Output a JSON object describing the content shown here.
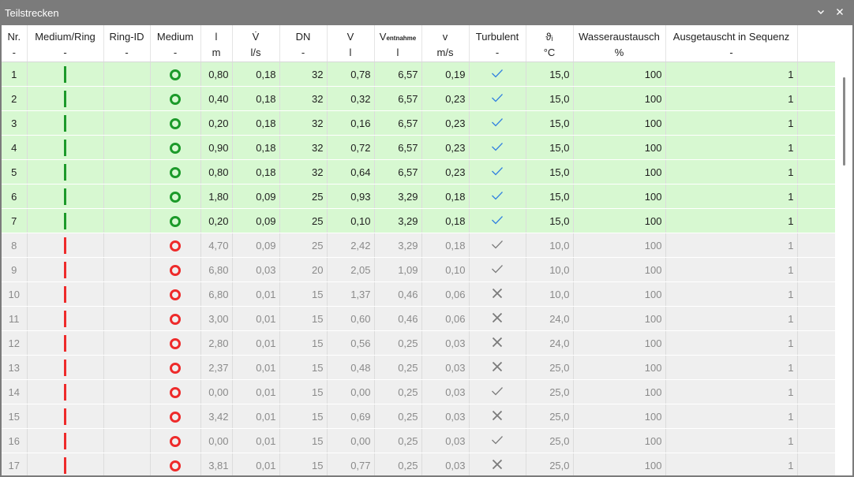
{
  "window": {
    "title": "Teilstrecken",
    "minimize_icon": "chevron-down",
    "close_icon": "close"
  },
  "columns": [
    {
      "key": "nr",
      "label": "Nr.",
      "unit": "-"
    },
    {
      "key": "medium_ring",
      "label": "Medium/Ring",
      "unit": "-"
    },
    {
      "key": "ring_id",
      "label": "Ring-ID",
      "unit": "-"
    },
    {
      "key": "medium",
      "label": "Medium",
      "unit": "-"
    },
    {
      "key": "l",
      "label": "l",
      "unit": "m"
    },
    {
      "key": "vdot",
      "label": "V̇",
      "unit": "l/s"
    },
    {
      "key": "dn",
      "label": "DN",
      "unit": "-"
    },
    {
      "key": "v",
      "label": "V",
      "unit": "l"
    },
    {
      "key": "ventnahme",
      "label": "V",
      "label_sub": "entnahme",
      "unit": "l"
    },
    {
      "key": "velocity",
      "label": "v",
      "unit": "m/s"
    },
    {
      "key": "turbulent",
      "label": "Turbulent",
      "unit": "-"
    },
    {
      "key": "theta",
      "label": "ϑᵢ",
      "unit": "°C"
    },
    {
      "key": "wasseraustausch",
      "label": "Wasseraustausch",
      "unit": "%"
    },
    {
      "key": "sequenz",
      "label": "Ausgetauscht in Sequenz",
      "unit": "-"
    }
  ],
  "colors": {
    "active_bar": "#1c9a2a",
    "inactive_bar": "#ee2b2b",
    "active_row": "#d7f8d1",
    "inactive_row": "#efefef",
    "check_active": "#2f7fe0",
    "mark_inactive": "#7a7a7a"
  },
  "rows": [
    {
      "nr": "1",
      "state": "active",
      "l": "0,80",
      "vdot": "0,18",
      "dn": "32",
      "v": "0,78",
      "ventnahme": "6,57",
      "velocity": "0,19",
      "turbulent": "check",
      "theta": "15,0",
      "wasseraustausch": "100",
      "sequenz": "1"
    },
    {
      "nr": "2",
      "state": "active",
      "l": "0,40",
      "vdot": "0,18",
      "dn": "32",
      "v": "0,32",
      "ventnahme": "6,57",
      "velocity": "0,23",
      "turbulent": "check",
      "theta": "15,0",
      "wasseraustausch": "100",
      "sequenz": "1"
    },
    {
      "nr": "3",
      "state": "active",
      "l": "0,20",
      "vdot": "0,18",
      "dn": "32",
      "v": "0,16",
      "ventnahme": "6,57",
      "velocity": "0,23",
      "turbulent": "check",
      "theta": "15,0",
      "wasseraustausch": "100",
      "sequenz": "1"
    },
    {
      "nr": "4",
      "state": "active",
      "l": "0,90",
      "vdot": "0,18",
      "dn": "32",
      "v": "0,72",
      "ventnahme": "6,57",
      "velocity": "0,23",
      "turbulent": "check",
      "theta": "15,0",
      "wasseraustausch": "100",
      "sequenz": "1"
    },
    {
      "nr": "5",
      "state": "active",
      "l": "0,80",
      "vdot": "0,18",
      "dn": "32",
      "v": "0,64",
      "ventnahme": "6,57",
      "velocity": "0,23",
      "turbulent": "check",
      "theta": "15,0",
      "wasseraustausch": "100",
      "sequenz": "1"
    },
    {
      "nr": "6",
      "state": "active",
      "l": "1,80",
      "vdot": "0,09",
      "dn": "25",
      "v": "0,93",
      "ventnahme": "3,29",
      "velocity": "0,18",
      "turbulent": "check",
      "theta": "15,0",
      "wasseraustausch": "100",
      "sequenz": "1"
    },
    {
      "nr": "7",
      "state": "active",
      "l": "0,20",
      "vdot": "0,09",
      "dn": "25",
      "v": "0,10",
      "ventnahme": "3,29",
      "velocity": "0,18",
      "turbulent": "check",
      "theta": "15,0",
      "wasseraustausch": "100",
      "sequenz": "1"
    },
    {
      "nr": "8",
      "state": "inactive",
      "l": "4,70",
      "vdot": "0,09",
      "dn": "25",
      "v": "2,42",
      "ventnahme": "3,29",
      "velocity": "0,18",
      "turbulent": "check",
      "theta": "10,0",
      "wasseraustausch": "100",
      "sequenz": "1"
    },
    {
      "nr": "9",
      "state": "inactive",
      "l": "6,80",
      "vdot": "0,03",
      "dn": "20",
      "v": "2,05",
      "ventnahme": "1,09",
      "velocity": "0,10",
      "turbulent": "check",
      "theta": "10,0",
      "wasseraustausch": "100",
      "sequenz": "1"
    },
    {
      "nr": "10",
      "state": "inactive",
      "l": "6,80",
      "vdot": "0,01",
      "dn": "15",
      "v": "1,37",
      "ventnahme": "0,46",
      "velocity": "0,06",
      "turbulent": "cross",
      "theta": "10,0",
      "wasseraustausch": "100",
      "sequenz": "1"
    },
    {
      "nr": "11",
      "state": "inactive",
      "l": "3,00",
      "vdot": "0,01",
      "dn": "15",
      "v": "0,60",
      "ventnahme": "0,46",
      "velocity": "0,06",
      "turbulent": "cross",
      "theta": "24,0",
      "wasseraustausch": "100",
      "sequenz": "1"
    },
    {
      "nr": "12",
      "state": "inactive",
      "l": "2,80",
      "vdot": "0,01",
      "dn": "15",
      "v": "0,56",
      "ventnahme": "0,25",
      "velocity": "0,03",
      "turbulent": "cross",
      "theta": "24,0",
      "wasseraustausch": "100",
      "sequenz": "1"
    },
    {
      "nr": "13",
      "state": "inactive",
      "l": "2,37",
      "vdot": "0,01",
      "dn": "15",
      "v": "0,48",
      "ventnahme": "0,25",
      "velocity": "0,03",
      "turbulent": "cross",
      "theta": "25,0",
      "wasseraustausch": "100",
      "sequenz": "1"
    },
    {
      "nr": "14",
      "state": "inactive",
      "l": "0,00",
      "vdot": "0,01",
      "dn": "15",
      "v": "0,00",
      "ventnahme": "0,25",
      "velocity": "0,03",
      "turbulent": "check",
      "theta": "25,0",
      "wasseraustausch": "100",
      "sequenz": "1"
    },
    {
      "nr": "15",
      "state": "inactive",
      "l": "3,42",
      "vdot": "0,01",
      "dn": "15",
      "v": "0,69",
      "ventnahme": "0,25",
      "velocity": "0,03",
      "turbulent": "cross",
      "theta": "25,0",
      "wasseraustausch": "100",
      "sequenz": "1"
    },
    {
      "nr": "16",
      "state": "inactive",
      "l": "0,00",
      "vdot": "0,01",
      "dn": "15",
      "v": "0,00",
      "ventnahme": "0,25",
      "velocity": "0,03",
      "turbulent": "check",
      "theta": "25,0",
      "wasseraustausch": "100",
      "sequenz": "1"
    },
    {
      "nr": "17",
      "state": "inactive",
      "l": "3,81",
      "vdot": "0,01",
      "dn": "15",
      "v": "0,77",
      "ventnahme": "0,25",
      "velocity": "0,03",
      "turbulent": "cross",
      "theta": "25,0",
      "wasseraustausch": "100",
      "sequenz": "1"
    }
  ]
}
